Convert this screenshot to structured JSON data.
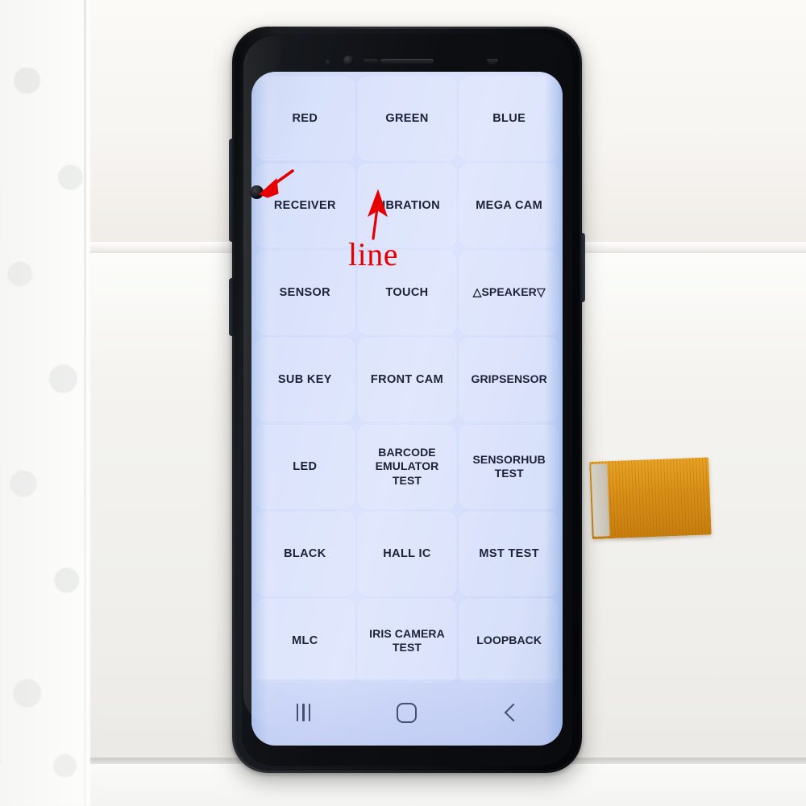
{
  "scene": {
    "subject": "smartphone-lcd-display-assembly",
    "surface_label": "white-board",
    "packaging_label": "bubble-wrap"
  },
  "device": {
    "name": "smartphone",
    "body_color": "#1b1e23",
    "screen_bg_color": "#d2dcfb",
    "label_color": "#1d2135",
    "sensors": {
      "earpiece": "earpiece-speaker-grille",
      "front_camera": "front-camera",
      "iris_scanner": "iris-scanner",
      "proximity": "proximity-sensor",
      "notification_led": "notification-led"
    },
    "side_buttons": {
      "volume": "volume-rocker",
      "assistant": "bixby-button",
      "power": "power-button"
    }
  },
  "screen": {
    "app": "factory-test-mode",
    "grid": {
      "columns": 3,
      "cells": [
        {
          "label": "RED",
          "wide": false
        },
        {
          "label": "GREEN",
          "wide": false
        },
        {
          "label": "BLUE",
          "wide": false
        },
        {
          "label": "RECEIVER",
          "wide": false
        },
        {
          "label": "VIBRATION",
          "wide": false
        },
        {
          "label": "MEGA CAM",
          "wide": false
        },
        {
          "label": "SENSOR",
          "wide": false
        },
        {
          "label": "TOUCH",
          "wide": false
        },
        {
          "label": "△SPEAKER▽",
          "wide": true
        },
        {
          "label": "SUB KEY",
          "wide": false
        },
        {
          "label": "FRONT CAM",
          "wide": false
        },
        {
          "label": "GRIPSENSOR",
          "wide": true
        },
        {
          "label": "LED",
          "wide": false
        },
        {
          "label": "BARCODE\nEMULATOR TEST",
          "wide": true
        },
        {
          "label": "SENSORHUB TEST",
          "wide": true
        },
        {
          "label": "BLACK",
          "wide": false
        },
        {
          "label": "HALL IC",
          "wide": false
        },
        {
          "label": "MST TEST",
          "wide": false
        },
        {
          "label": "MLC",
          "wide": false
        },
        {
          "label": "IRIS CAMERA\nTEST",
          "wide": true
        },
        {
          "label": "LOOPBACK",
          "wide": true
        }
      ]
    },
    "nav_bar": {
      "recents": "recents-icon",
      "home": "home-icon",
      "back": "back-icon"
    }
  },
  "flex_cable": {
    "name": "display-flex-cable",
    "ribbon_color": "#d98f16",
    "connector_color": "#cfcabd"
  },
  "annotations": {
    "color": "#e60000",
    "defect_label": "line",
    "arrow_to_defect": "arrow-pointing-to-dark-spot",
    "arrow_to_line": "arrow-pointing-to-display-line"
  }
}
